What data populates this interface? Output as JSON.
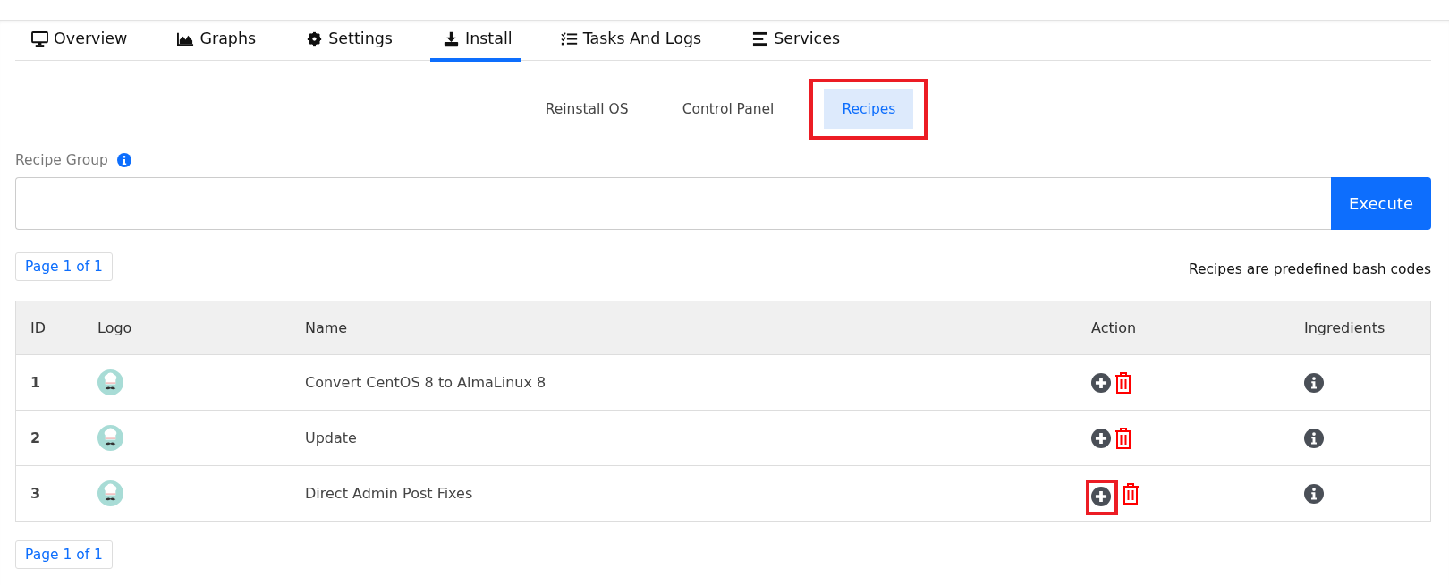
{
  "tabs": [
    {
      "label": "Overview",
      "kind": "monitor",
      "selected": false
    },
    {
      "label": "Graphs",
      "kind": "chart",
      "selected": false
    },
    {
      "label": "Settings",
      "kind": "gear",
      "selected": false
    },
    {
      "label": "Install",
      "kind": "download",
      "selected": true
    },
    {
      "label": "Tasks And Logs",
      "kind": "tasks",
      "selected": false
    },
    {
      "label": "Services",
      "kind": "bars",
      "selected": false
    }
  ],
  "subtabs": [
    {
      "label": "Reinstall OS",
      "selected": false,
      "highlighted": false
    },
    {
      "label": "Control Panel",
      "selected": false,
      "highlighted": false
    },
    {
      "label": "Recipes",
      "selected": true,
      "highlighted": true
    }
  ],
  "recipe_group": {
    "label": "Recipe Group"
  },
  "execute_button": "Execute",
  "pager_top": "Page 1 of 1",
  "note": "Recipes are predefined bash codes",
  "table": {
    "columns": [
      "ID",
      "Logo",
      "Name",
      "Action",
      "Ingredients"
    ],
    "rows": [
      {
        "id": "1",
        "name": "Convert CentOS 8 to AlmaLinux 8",
        "add_highlighted": false
      },
      {
        "id": "2",
        "name": "Update",
        "add_highlighted": false
      },
      {
        "id": "3",
        "name": "Direct Admin Post Fixes",
        "add_highlighted": true
      }
    ]
  },
  "pager_bottom": "Page 1 of 1"
}
